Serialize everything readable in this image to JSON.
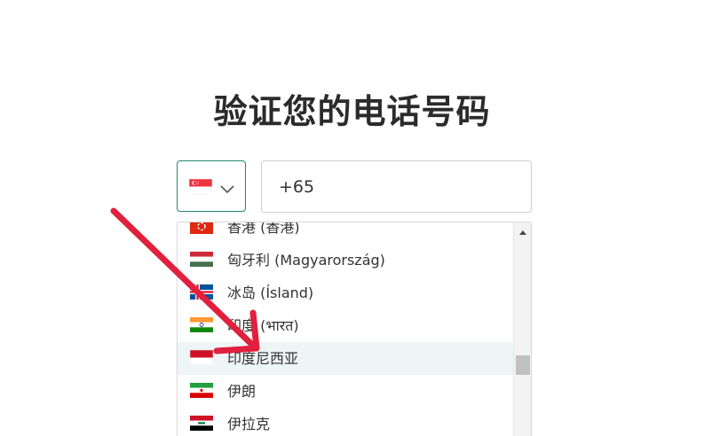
{
  "title": "验证您的电话号码",
  "country_select": {
    "selected_flag": "flag-singapore-icon",
    "chevron_icon": "chevron-down-icon"
  },
  "phone_input": {
    "value": "+65"
  },
  "dropdown": {
    "items": [
      {
        "flag": "flag-hong-kong-icon",
        "label": "香港 (香港)"
      },
      {
        "flag": "flag-hungary-icon",
        "label": "匈牙利 (Magyarország)"
      },
      {
        "flag": "flag-iceland-icon",
        "label": "冰岛 (Ísland)"
      },
      {
        "flag": "flag-india-icon",
        "label": "印度 (भारत)"
      },
      {
        "flag": "flag-indonesia-icon",
        "label": "印度尼西亚",
        "hovered": true
      },
      {
        "flag": "flag-iran-icon",
        "label": "伊朗"
      },
      {
        "flag": "flag-iraq-icon",
        "label": "伊拉克"
      }
    ]
  },
  "annotation": {
    "arrow_icon": "red-arrow-icon",
    "arrow_color": "#e0203c"
  },
  "colors": {
    "focus_border": "#1f8a73",
    "hover_bg": "#eef5f7",
    "title_text": "#2b2b2b"
  }
}
